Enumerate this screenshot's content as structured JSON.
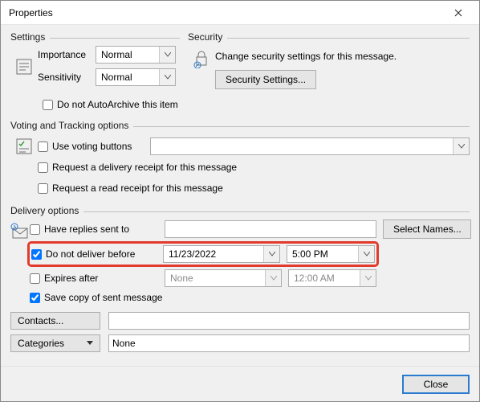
{
  "title": "Properties",
  "settings": {
    "group_label": "Settings",
    "importance_label": "Importance",
    "importance_value": "Normal",
    "sensitivity_label": "Sensitivity",
    "sensitivity_value": "Normal",
    "autoarchive_label": "Do not AutoArchive this item",
    "autoarchive_checked": false
  },
  "security": {
    "group_label": "Security",
    "desc": "Change security settings for this message.",
    "button_label": "Security Settings..."
  },
  "voting": {
    "group_label": "Voting and Tracking options",
    "use_voting_label": "Use voting buttons",
    "use_voting_checked": false,
    "voting_value": "",
    "delivery_receipt_label": "Request a delivery receipt for this message",
    "delivery_receipt_checked": false,
    "read_receipt_label": "Request a read receipt for this message",
    "read_receipt_checked": false
  },
  "delivery": {
    "group_label": "Delivery options",
    "have_replies_label": "Have replies sent to",
    "have_replies_checked": false,
    "have_replies_value": "",
    "select_names_label": "Select Names...",
    "do_not_deliver_label": "Do not deliver before",
    "do_not_deliver_checked": true,
    "do_not_deliver_date": "11/23/2022",
    "do_not_deliver_time": "5:00 PM",
    "expires_label": "Expires after",
    "expires_checked": false,
    "expires_date": "None",
    "expires_time": "12:00 AM",
    "save_copy_label": "Save copy of sent message",
    "save_copy_checked": true
  },
  "lower": {
    "contacts_label": "Contacts...",
    "contacts_value": "",
    "categories_label": "Categories",
    "categories_value": "None"
  },
  "close_label": "Close"
}
